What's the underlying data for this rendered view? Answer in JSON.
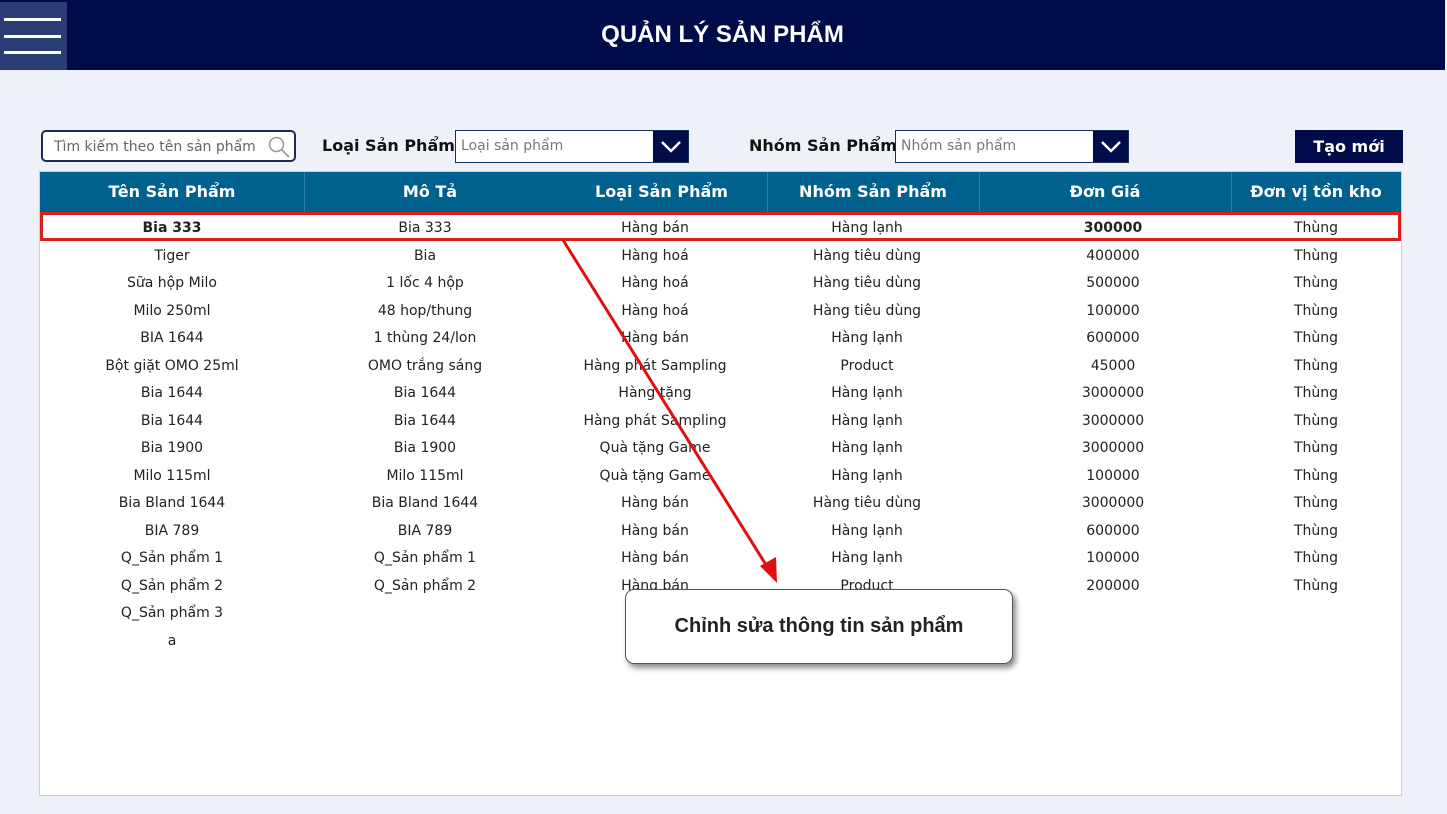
{
  "header": {
    "title": "QUẢN LÝ SẢN PHẨM"
  },
  "search": {
    "placeholder": "Tìm kiếm theo tên sản phẩm"
  },
  "filters": {
    "type_label": "Loại Sản Phẩm",
    "type_placeholder": "Loại sản phẩm",
    "group_label": "Nhóm Sản Phẩm",
    "group_placeholder": "Nhóm sản phẩm"
  },
  "create_label": "Tạo mới",
  "table": {
    "columns": [
      "Tên Sản Phẩm",
      "Mô Tả",
      "Loại Sản Phẩm",
      "Nhóm Sản Phẩm",
      "Đơn Giá",
      "Đơn vị tồn kho"
    ],
    "rows": [
      [
        "Bia 333",
        "Bia 333",
        "Hàng bán",
        "Hàng lạnh",
        "300000",
        "Thùng"
      ],
      [
        "Tiger",
        "Bia",
        "Hàng hoá",
        "Hàng tiêu dùng",
        "400000",
        "Thùng"
      ],
      [
        "Sữa hộp Milo",
        "1 lốc 4 hộp",
        "Hàng hoá",
        "Hàng tiêu dùng",
        "500000",
        "Thùng"
      ],
      [
        "Milo 250ml",
        "48 hop/thung",
        "Hàng hoá",
        "Hàng tiêu dùng",
        "100000",
        "Thùng"
      ],
      [
        "BIA 1644",
        "1 thùng 24/lon",
        "Hàng bán",
        "Hàng lạnh",
        "600000",
        "Thùng"
      ],
      [
        "Bột giặt OMO 25ml",
        "OMO trắng sáng",
        "Hàng phát Sampling",
        "Product",
        "45000",
        "Thùng"
      ],
      [
        "Bia 1644",
        "Bia 1644",
        "Hàng tặng",
        "Hàng lạnh",
        "3000000",
        "Thùng"
      ],
      [
        "Bia 1644",
        "Bia 1644",
        "Hàng phát Sampling",
        "Hàng lạnh",
        "3000000",
        "Thùng"
      ],
      [
        "Bia 1900",
        "Bia 1900",
        "Quà tặng Game",
        "Hàng lạnh",
        "3000000",
        "Thùng"
      ],
      [
        "Milo 115ml",
        "Milo 115ml",
        "Quà tặng Game",
        "Hàng lạnh",
        "100000",
        "Thùng"
      ],
      [
        "Bia Bland 1644",
        "Bia Bland 1644",
        "Hàng bán",
        "Hàng tiêu dùng",
        "3000000",
        "Thùng"
      ],
      [
        "BIA 789",
        "BIA 789",
        "Hàng bán",
        "Hàng lạnh",
        "600000",
        "Thùng"
      ],
      [
        "Q_Sản phẩm 1",
        "Q_Sản phẩm 1",
        "Hàng bán",
        "Hàng lạnh",
        "100000",
        "Thùng"
      ],
      [
        "Q_Sản phẩm 2",
        "Q_Sản phẩm 2",
        "Hàng bán",
        "Product",
        "200000",
        "Thùng"
      ],
      [
        "Q_Sản phẩm 3",
        "",
        "",
        "",
        "",
        ""
      ],
      [
        "a",
        "",
        "",
        "",
        "",
        ""
      ]
    ]
  },
  "callout": {
    "text": "Chỉnh sửa thông tin sản phẩm"
  },
  "colors": {
    "header_bg": "#000c4a",
    "table_header_bg": "#00618f",
    "highlight": "#dd1f1f"
  }
}
